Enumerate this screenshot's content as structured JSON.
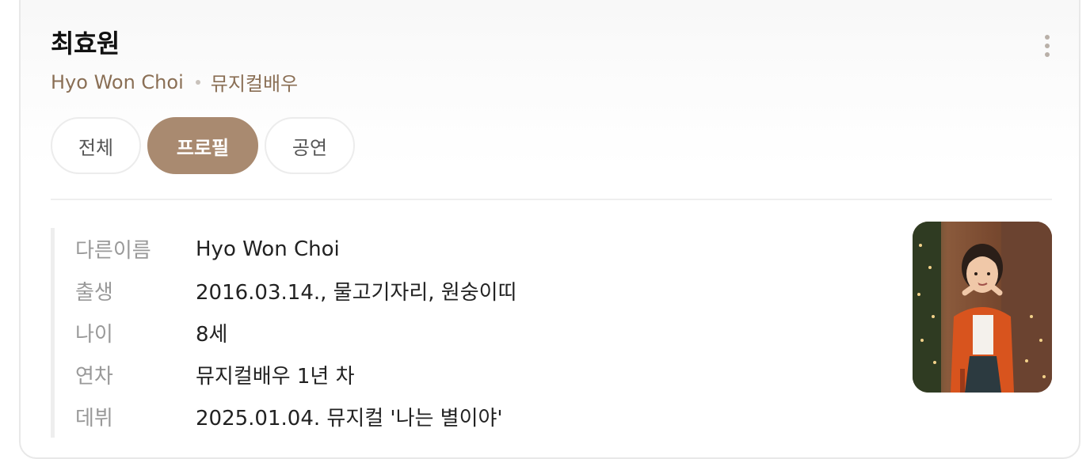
{
  "profile": {
    "name": "최효원",
    "english_name": "Hyo Won Choi",
    "occupation": "뮤지컬배우"
  },
  "tabs": [
    {
      "label": "전체",
      "active": false
    },
    {
      "label": "프로필",
      "active": true
    },
    {
      "label": "공연",
      "active": false
    }
  ],
  "info": [
    {
      "label": "다른이름",
      "value": "Hyo Won Choi"
    },
    {
      "label": "출생",
      "value": "2016.03.14., 물고기자리, 원숭이띠"
    },
    {
      "label": "나이",
      "value": "8세"
    },
    {
      "label": "연차",
      "value": "뮤지컬배우 1년 차"
    },
    {
      "label": "데뷔",
      "value": "2025.01.04. 뮤지컬 '나는 별이야'"
    }
  ],
  "colors": {
    "accent": "#a98a70",
    "subtitle": "#8a6f55",
    "label": "#999999"
  },
  "icons": {
    "more": "more-vertical-icon"
  }
}
